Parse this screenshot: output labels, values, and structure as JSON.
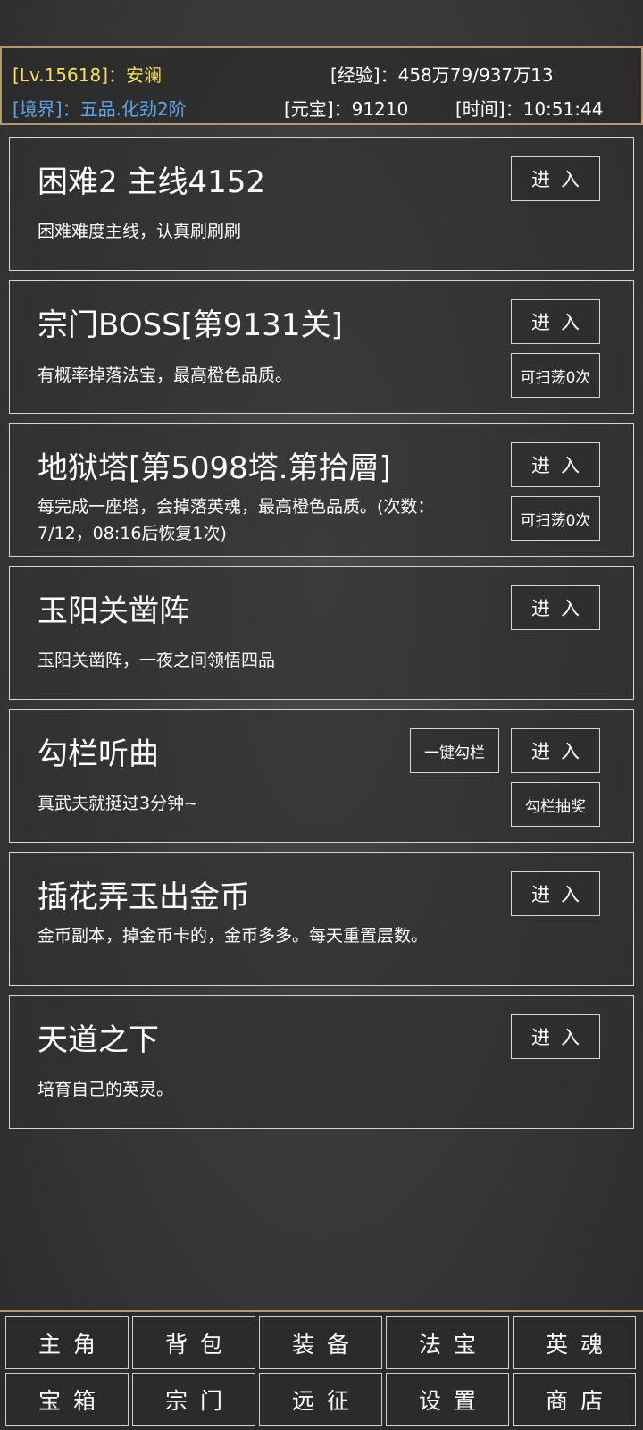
{
  "status": {
    "level": "[Lv.15618]：安澜",
    "exp": "[经验]：458万79/937万13",
    "realm": "[境界]：五品.化劲2阶",
    "yuanbao": "[元宝]：91210",
    "time": "[时间]：10:51:44"
  },
  "panels": [
    {
      "title": "困难2 主线4152",
      "desc": "困难难度主线，认真刷刷刷",
      "enter": "进入"
    },
    {
      "title": "宗门BOSS[第9131关]",
      "desc": "有概率掉落法宝，最高橙色品质。",
      "enter": "进入",
      "sweep": "可扫荡0次"
    },
    {
      "title": "地狱塔[第5098塔.第拾層]",
      "desc": "每完成一座塔，会掉落英魂，最高橙色品质。(次数：7/12，08:16后恢复1次)",
      "enter": "进入",
      "sweep": "可扫荡0次"
    },
    {
      "title": "玉阳关凿阵",
      "desc": "玉阳关凿阵，一夜之间领悟四品",
      "enter": "进入"
    },
    {
      "title": "勾栏听曲",
      "desc": "真武夫就挺过3分钟~",
      "enter": "进入",
      "onekey": "一键勾栏",
      "lottery": "勾栏抽奖"
    },
    {
      "title": "插花弄玉出金币",
      "desc": "金币副本，掉金币卡的，金币多多。每天重置层数。",
      "enter": "进入"
    },
    {
      "title": "天道之下",
      "desc": "培育自己的英灵。",
      "enter": "进入"
    }
  ],
  "nav": [
    "主角",
    "背包",
    "装备",
    "法宝",
    "英魂",
    "宝箱",
    "宗门",
    "远征",
    "设置",
    "商店"
  ]
}
